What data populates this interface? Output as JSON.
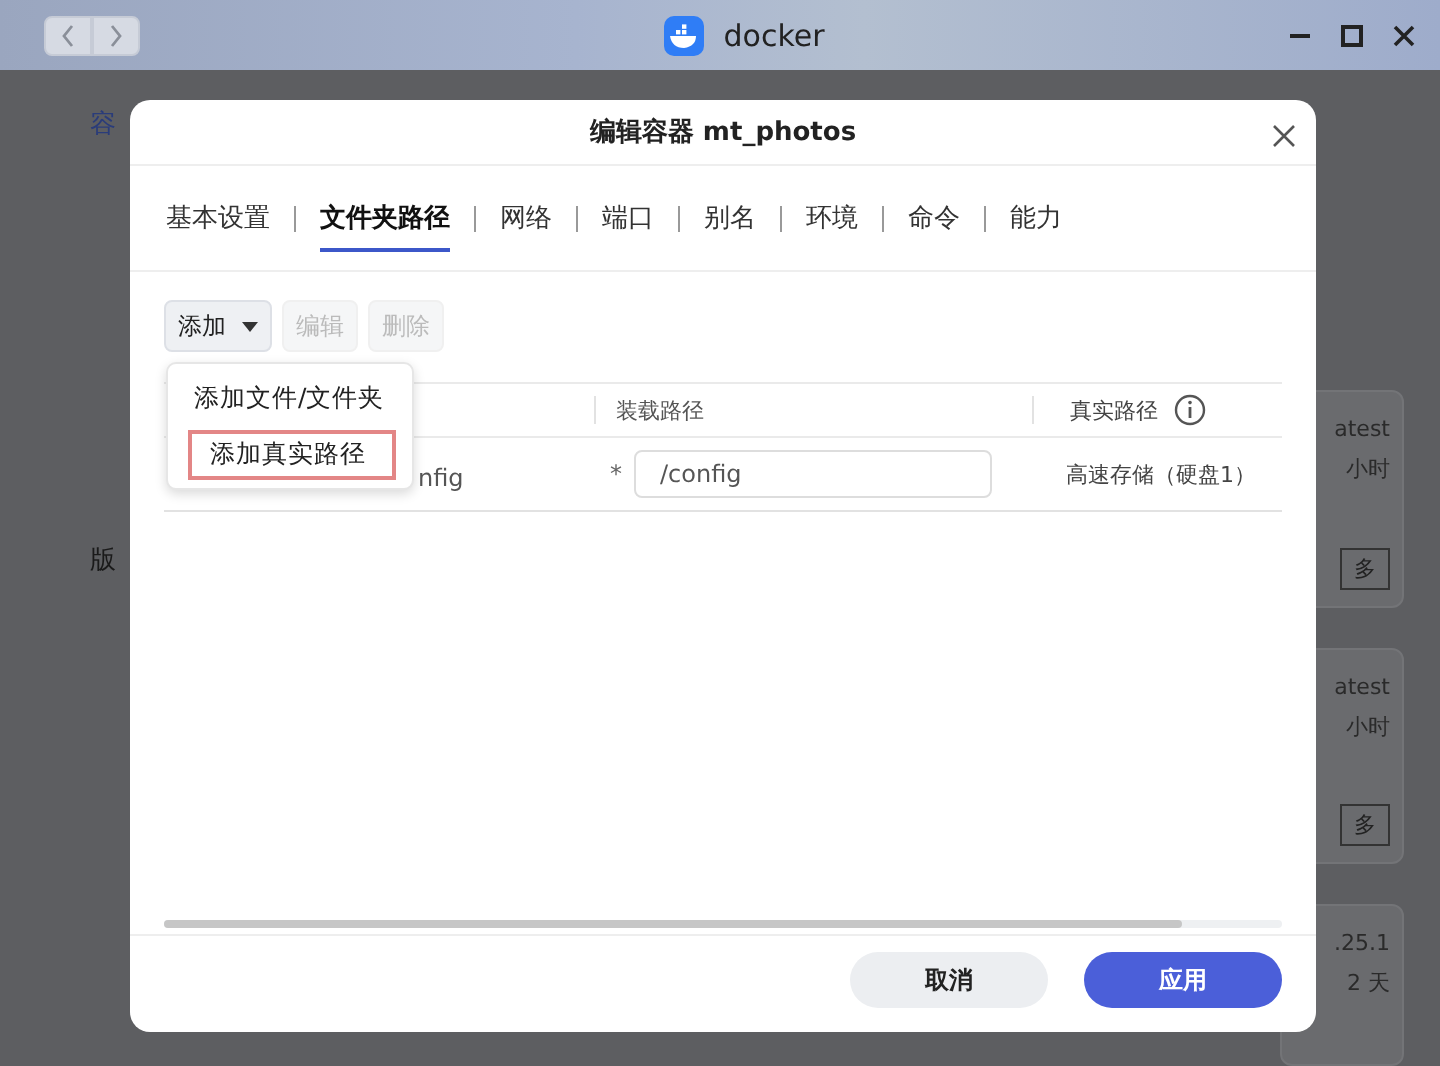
{
  "window": {
    "title": "docker"
  },
  "background": {
    "sidebar": [
      "容",
      "版"
    ],
    "cards": [
      {
        "lines": [
          "atest",
          "小时"
        ],
        "button": "多"
      },
      {
        "lines": [
          "atest",
          "小时"
        ],
        "button": "多"
      },
      {
        "lines": [
          ".25.1",
          "2 天"
        ]
      }
    ]
  },
  "dialog": {
    "title": "编辑容器 mt_photos",
    "tabs": [
      {
        "label": "基本设置",
        "selected": false
      },
      {
        "label": "文件夹路径",
        "selected": true
      },
      {
        "label": "网络",
        "selected": false
      },
      {
        "label": "端口",
        "selected": false
      },
      {
        "label": "别名",
        "selected": false
      },
      {
        "label": "环境",
        "selected": false
      },
      {
        "label": "命令",
        "selected": false
      },
      {
        "label": "能力",
        "selected": false
      }
    ],
    "toolbar": [
      {
        "label": "添加",
        "kind": "dropdown",
        "disabled": false
      },
      {
        "label": "编辑",
        "kind": "button",
        "disabled": true
      },
      {
        "label": "删除",
        "kind": "button",
        "disabled": true
      }
    ],
    "menu": [
      {
        "label": "添加文件/文件夹",
        "selected": false
      },
      {
        "label": "添加真实路径",
        "selected": true
      }
    ],
    "table": {
      "columns": [
        "装载路径",
        "真实路径"
      ],
      "rows": [
        {
          "column_1": "nfig",
          "required_mark": "*",
          "mount_path": "/config",
          "real_path": "高速存储（硬盘1）"
        }
      ]
    },
    "buttons": [
      {
        "label": "取消",
        "kind": "secondary"
      },
      {
        "label": "应用",
        "kind": "primary"
      }
    ]
  }
}
